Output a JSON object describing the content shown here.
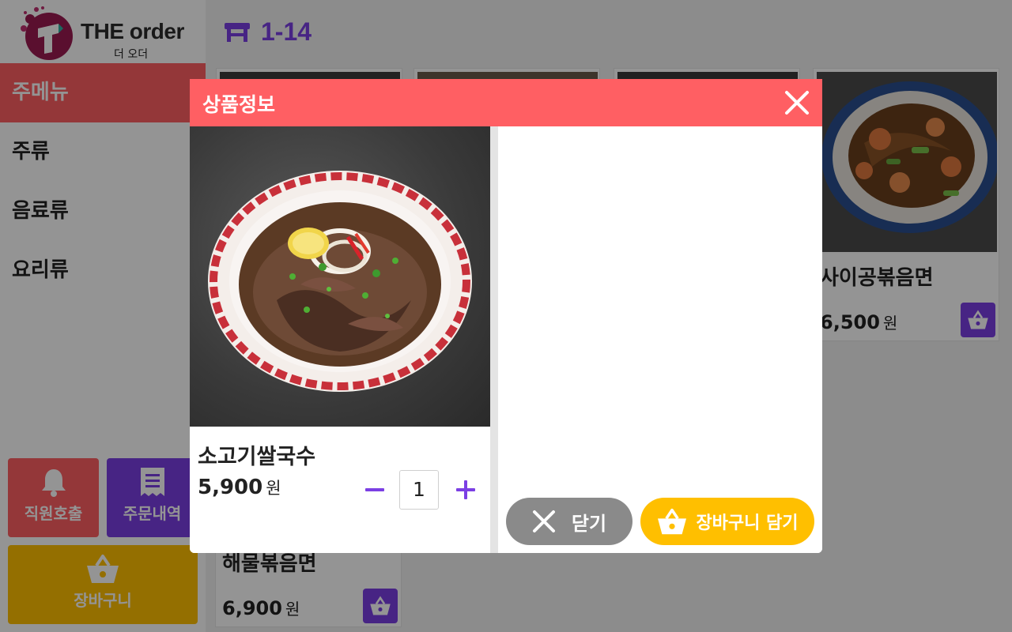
{
  "brand": {
    "name": "THE order",
    "subtitle": "더 오더"
  },
  "table": {
    "number": "1-14"
  },
  "sidebar": {
    "categories": [
      {
        "label": "주메뉴",
        "active": true
      },
      {
        "label": "주류",
        "active": false
      },
      {
        "label": "음료류",
        "active": false
      },
      {
        "label": "요리류",
        "active": false
      }
    ],
    "call_staff": "직원호출",
    "order_history": "주문내역",
    "cart": "장바구니"
  },
  "menu": {
    "items": [
      {
        "name": "사이공볶음면",
        "price": "6,500",
        "currency": "원"
      },
      {
        "name": "해물볶음면",
        "price": "6,900",
        "currency": "원"
      }
    ]
  },
  "modal": {
    "title": "상품정보",
    "product": {
      "name": "소고기쌀국수",
      "price": "5,900",
      "currency": "원"
    },
    "quantity": "1",
    "close_label": "닫기",
    "add_to_cart_label": "장바구니 담기"
  },
  "colors": {
    "primary_red": "#ff5f63",
    "purple": "#7b3fe4",
    "yellow": "#ffbf00",
    "gray_button": "#8a8a8a"
  }
}
